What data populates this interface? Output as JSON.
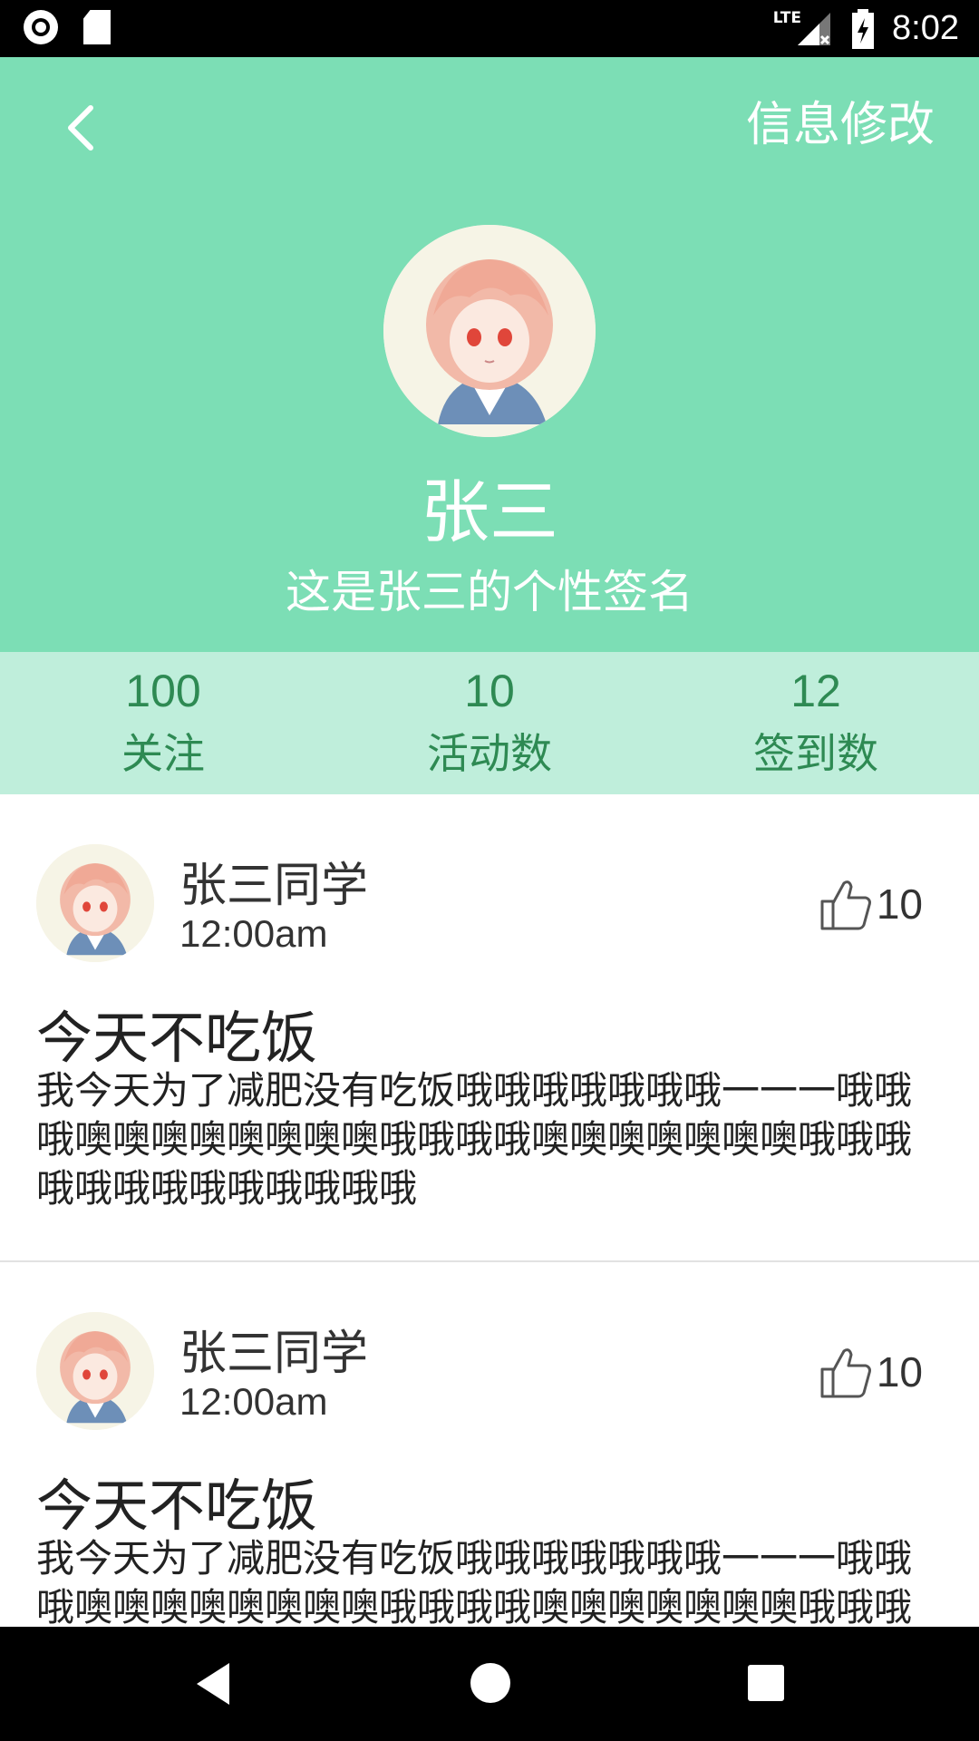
{
  "status_bar": {
    "network": "LTE",
    "time": "8:02"
  },
  "header": {
    "edit_label": "信息修改",
    "name": "张三",
    "signature": "这是张三的个性签名",
    "bg_color": "#7cdeb5"
  },
  "stats": [
    {
      "value": "100",
      "label": "关注"
    },
    {
      "value": "10",
      "label": "活动数"
    },
    {
      "value": "12",
      "label": "签到数"
    }
  ],
  "posts": [
    {
      "author": "张三同学",
      "time": "12:00am",
      "likes": "10",
      "title": "今天不吃饭",
      "body": "我今天为了减肥没有吃饭哦哦哦哦哦哦哦一一一哦哦哦噢噢噢噢噢噢噢噢哦哦哦哦噢噢噢噢噢噢噢哦哦哦哦哦哦哦哦哦哦哦哦哦"
    },
    {
      "author": "张三同学",
      "time": "12:00am",
      "likes": "10",
      "title": "今天不吃饭",
      "body": "我今天为了减肥没有吃饭哦哦哦哦哦哦哦一一一哦哦哦噢噢噢噢噢噢噢噢哦哦哦哦噢噢噢噢噢噢噢哦哦哦哦哦哦哦哦哦哦哦哦哦"
    }
  ]
}
